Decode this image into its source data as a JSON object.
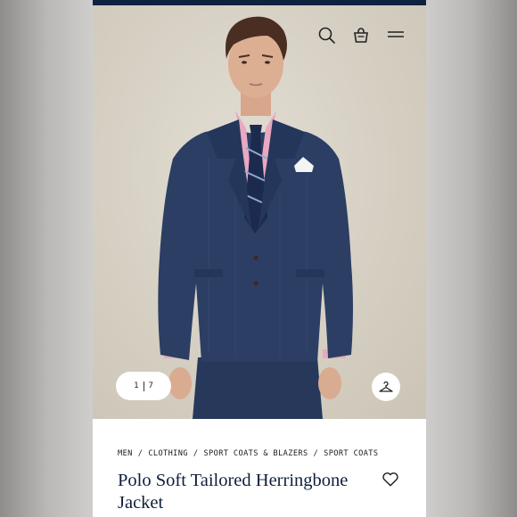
{
  "header": {
    "icons": [
      "search-icon",
      "shopping-bag-icon",
      "menu-icon"
    ]
  },
  "gallery": {
    "current": "1",
    "total": "7",
    "hanger_icon": "hanger-icon"
  },
  "breadcrumb": [
    "MEN",
    "CLOTHING",
    "SPORT COATS & BLAZERS",
    "SPORT COATS"
  ],
  "product": {
    "title": "Polo Soft Tailored Herringbone Jacket",
    "wishlist_icon": "heart-icon"
  },
  "colors": {
    "brand_navy": "#0e2240",
    "jacket_navy": "#2c3e63",
    "shirt_pink": "#e6a6be",
    "backdrop": "#d8d2c6"
  }
}
